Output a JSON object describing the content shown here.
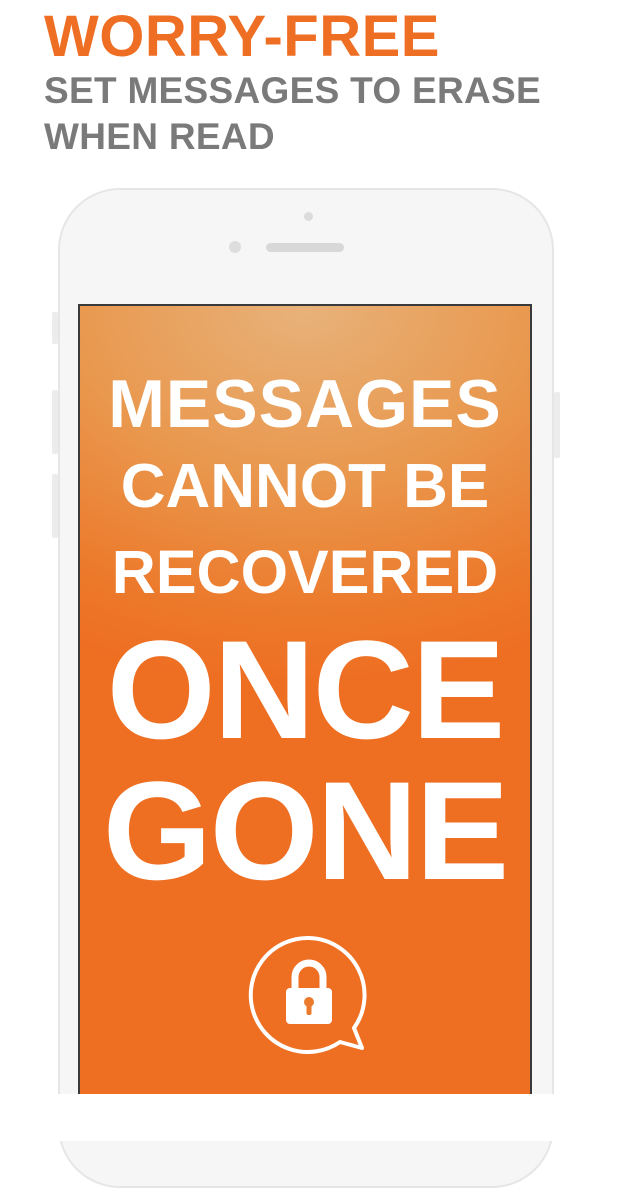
{
  "header": {
    "title": "WORRY-FREE",
    "subtitle": "SET MESSAGES TO ERASE WHEN READ"
  },
  "screen": {
    "line1": "MESSAGES",
    "line2": "CANNOT BE",
    "line3": "RECOVERED",
    "line4": "ONCE",
    "line5": "GONE",
    "badge_icon": "lock-chat-bubble-icon"
  },
  "colors": {
    "accent": "#ee6f24",
    "subtitle": "#7a7a7a",
    "screen_top": "#e8b27a",
    "screen_bottom": "#ee6e22",
    "phone_body": "#f6f6f6"
  }
}
